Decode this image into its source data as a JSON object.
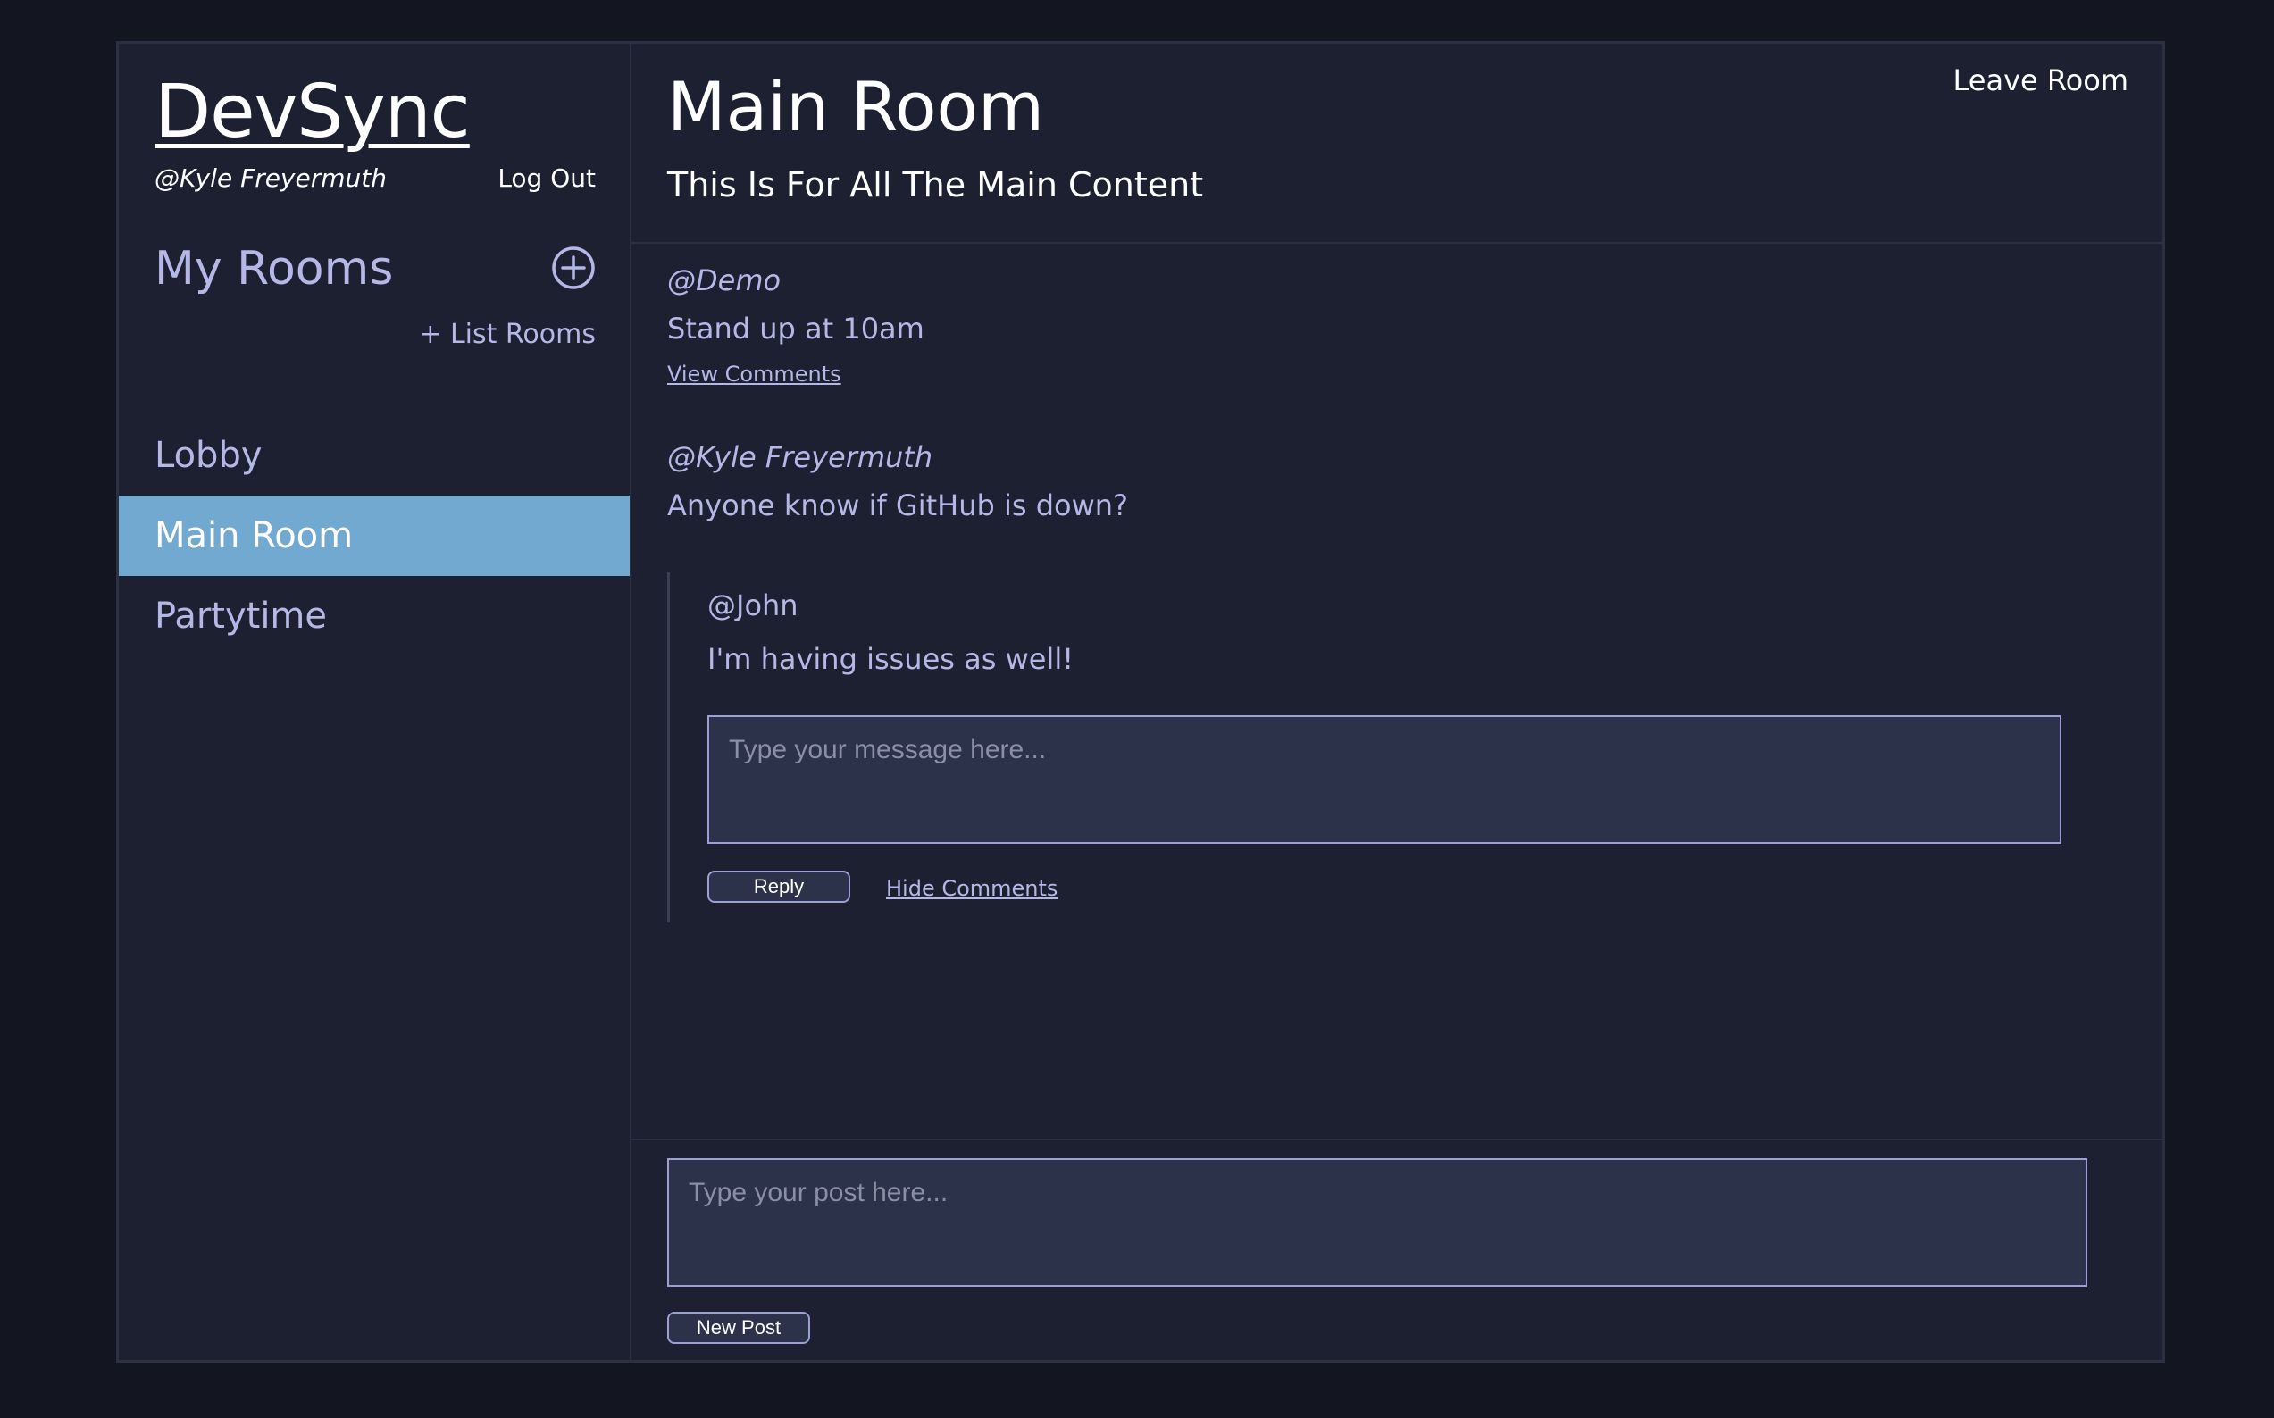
{
  "sidebar": {
    "brand": "DevSync",
    "username": "@Kyle Freyermuth",
    "logout_label": "Log Out",
    "my_rooms_title": "My Rooms",
    "add_room_icon": "plus-circle-icon",
    "list_rooms_label": "+ List Rooms",
    "rooms": [
      {
        "label": "Lobby",
        "active": false
      },
      {
        "label": "Main Room",
        "active": true
      },
      {
        "label": "Partytime",
        "active": false
      }
    ]
  },
  "header": {
    "title": "Main Room",
    "description": "This Is For All The Main Content",
    "leave_label": "Leave Room"
  },
  "posts": [
    {
      "author": "@Demo",
      "body": "Stand up at 10am",
      "view_comments_label": "View Comments"
    },
    {
      "author": "@Kyle Freyermuth",
      "body": "Anyone know if GitHub is down?",
      "comments": [
        {
          "author": "@John",
          "body": "I'm having issues as well!"
        }
      ],
      "reply_placeholder": "Type your message here...",
      "reply_label": "Reply",
      "hide_comments_label": "Hide Comments"
    }
  ],
  "composer": {
    "placeholder": "Type your post here...",
    "button_label": "New Post"
  },
  "colors": {
    "page_bg": "#131521",
    "panel_bg": "#1d2030",
    "accent": "#72a9d0",
    "muted_text": "#b4b8e6",
    "input_bg": "#2b324a"
  }
}
